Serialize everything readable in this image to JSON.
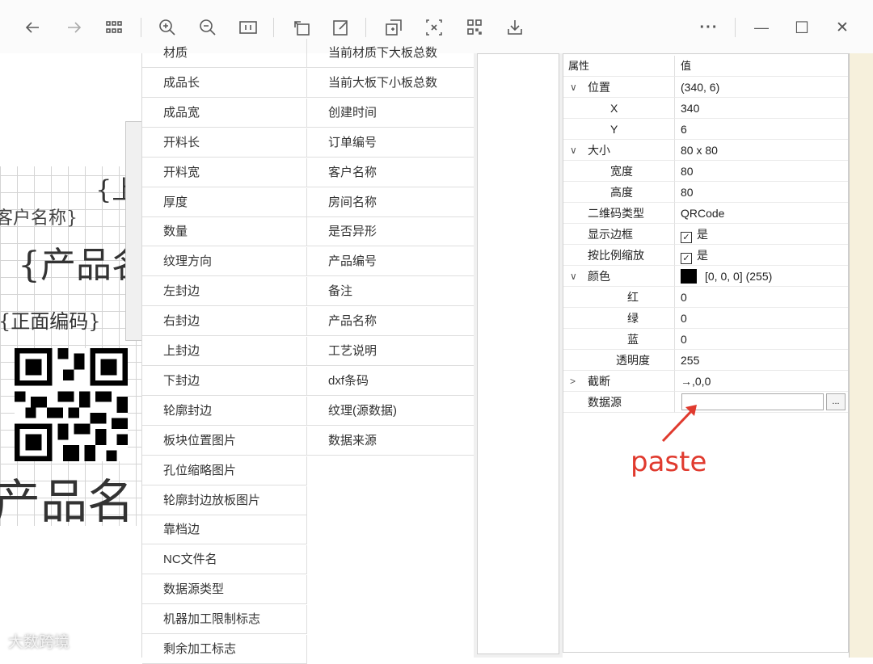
{
  "toolbar": {
    "back_icon": "arrow-left",
    "forward_icon": "arrow-right",
    "more_label": "···",
    "minimize_label": "—",
    "maximize_label": "☐",
    "close_label": "✕"
  },
  "canvas": {
    "top_partial_label": "{上",
    "customer_label": "客户名称}",
    "product_label": "{产品名",
    "front_code_label": "{正面编码}",
    "bottom_product_label": "产品名"
  },
  "field_list": {
    "col1": [
      "材质",
      "成品长",
      "成品宽",
      "开料长",
      "开料宽",
      "厚度",
      "数量",
      "纹理方向",
      "左封边",
      "右封边",
      "上封边",
      "下封边",
      "轮廓封边",
      "板块位置图片",
      "孔位缩略图片",
      "轮廓封边放板图片",
      "靠档边",
      "NC文件名",
      "数据源类型",
      "机器加工限制标志",
      "剩余加工标志"
    ],
    "col2": [
      "当前材质下大板总数",
      "当前大板下小板总数",
      "创建时间",
      "订单编号",
      "客户名称",
      "房间名称",
      "是否异形",
      "产品编号",
      "备注",
      "产品名称",
      "工艺说明",
      "dxf条码",
      "纹理(源数据)",
      "数据来源"
    ]
  },
  "properties": {
    "header_name": "属性",
    "header_value": "值",
    "rows": [
      {
        "name": "位置",
        "value": "(340, 6)",
        "expander": "∨",
        "indent": 1
      },
      {
        "name": "X",
        "value": "340",
        "expander": "",
        "indent": 2
      },
      {
        "name": "Y",
        "value": "6",
        "expander": "",
        "indent": 2
      },
      {
        "name": "大小",
        "value": "80 x 80",
        "expander": "∨",
        "indent": 1
      },
      {
        "name": "宽度",
        "value": "80",
        "expander": "",
        "indent": 2
      },
      {
        "name": "高度",
        "value": "80",
        "expander": "",
        "indent": 2
      },
      {
        "name": "二维码类型",
        "value": "QRCode",
        "expander": "",
        "indent": 1
      },
      {
        "name": "显示边框",
        "value": "是",
        "expander": "",
        "indent": 1,
        "check": true
      },
      {
        "name": "按比例缩放",
        "value": "是",
        "expander": "",
        "indent": 1,
        "check": true
      },
      {
        "name": "颜色",
        "value": "[0, 0, 0] (255)",
        "expander": "∨",
        "indent": 1,
        "swatch": "#000000"
      },
      {
        "name": "红",
        "value": "0",
        "expander": "",
        "indent": 3
      },
      {
        "name": "绿",
        "value": "0",
        "expander": "",
        "indent": 3
      },
      {
        "name": "蓝",
        "value": "0",
        "expander": "",
        "indent": 3
      },
      {
        "name": "透明度",
        "value": "255",
        "expander": "",
        "indent": 3
      },
      {
        "name": "截断",
        "value": "→,0,0",
        "expander": ">",
        "indent": 1
      },
      {
        "name": "数据源",
        "value": "",
        "expander": "",
        "indent": 1,
        "input": true
      }
    ],
    "ellipsis_label": "..."
  },
  "annotation": {
    "text": "paste",
    "color": "#e03a2e"
  },
  "watermark": "大数跨境"
}
